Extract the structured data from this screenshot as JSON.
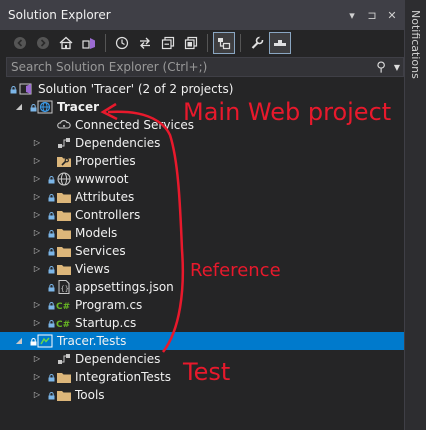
{
  "panel": {
    "title": "Solution Explorer",
    "title_buttons": [
      "▾",
      "⊐",
      "✕"
    ]
  },
  "search": {
    "placeholder": "Search Solution Explorer (Ctrl+;)"
  },
  "toolbar": {
    "items": [
      "back-icon",
      "forward-icon",
      "home-icon",
      "vs-switch-views-icon",
      "history-icon",
      "sync-icon",
      "collapse-all-icon",
      "show-all-files-icon",
      "preview-selected-icon",
      "properties-wrench-icon",
      "pending-changes-icon"
    ]
  },
  "tree": {
    "solution": "Solution 'Tracer' (2 of 2 projects)",
    "tracer": "Tracer",
    "tracer_children": [
      "Connected Services",
      "Dependencies",
      "Properties",
      "wwwroot",
      "Attributes",
      "Controllers",
      "Models",
      "Services",
      "Views",
      "appsettings.json",
      "Program.cs",
      "Startup.cs"
    ],
    "tests": "Tracer.Tests",
    "tests_children": [
      "Dependencies",
      "IntegrationTests",
      "Tools"
    ]
  },
  "side_tab": {
    "label": "Notifications"
  },
  "annotations": {
    "main": "Main Web project",
    "reference": "Reference",
    "test": "Test"
  },
  "colors": {
    "selection": "#007acc",
    "annotation": "#e8192c",
    "folder": "#dcb67a",
    "csharp": "#68b723"
  }
}
